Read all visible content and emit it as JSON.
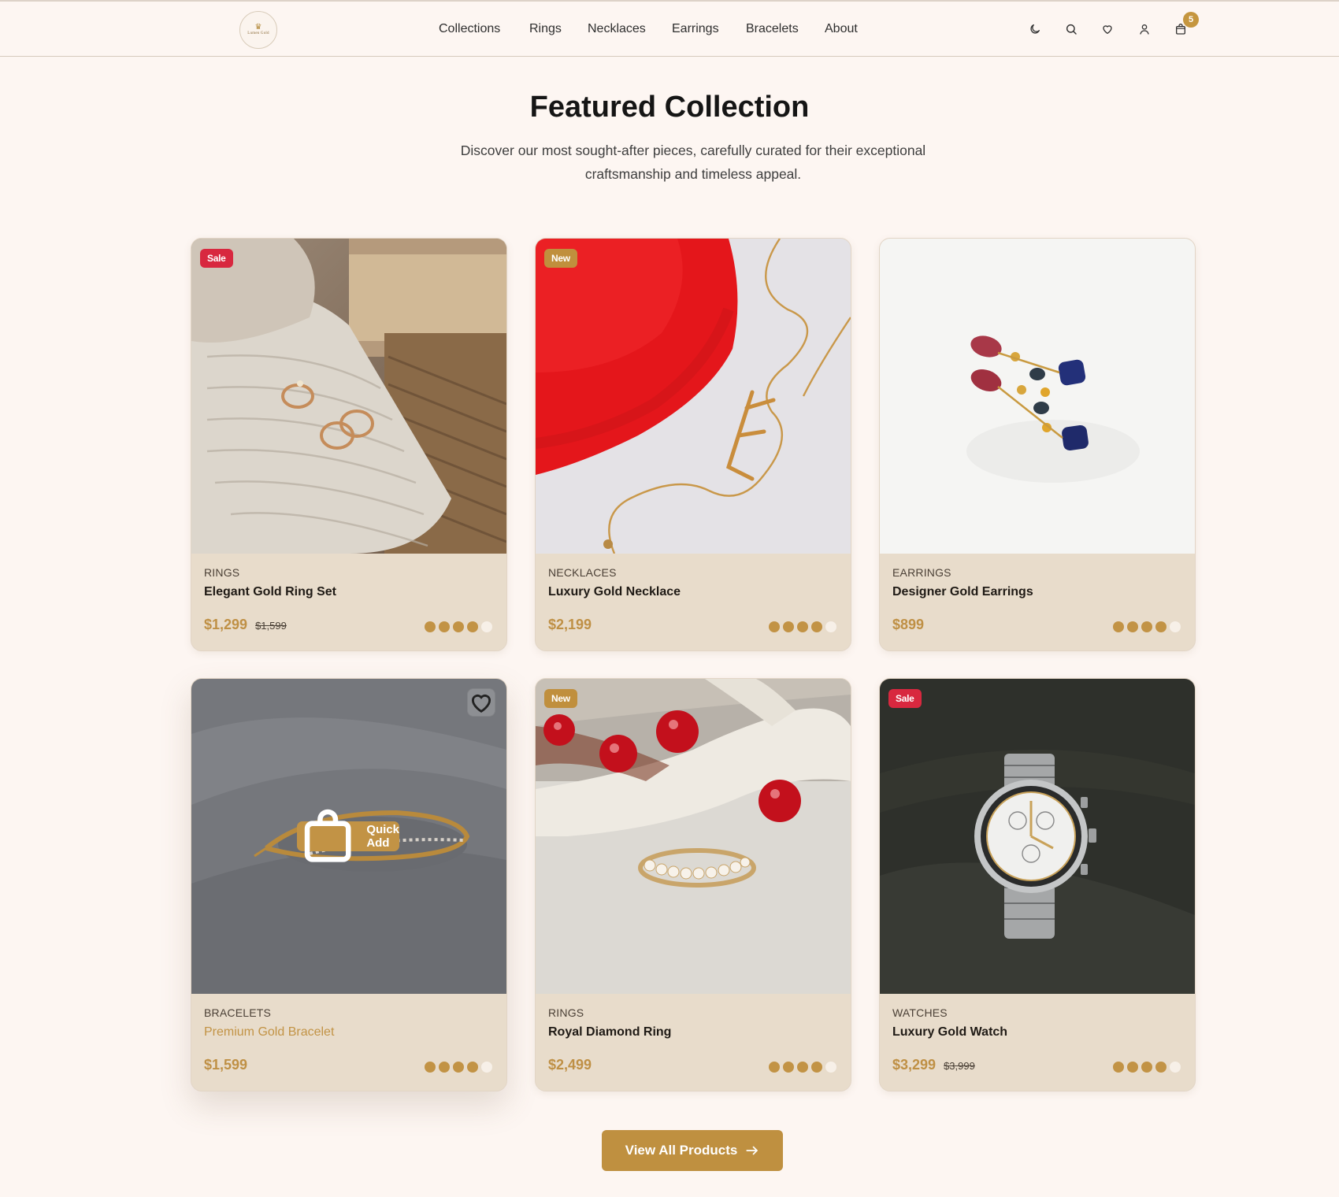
{
  "brand": {
    "logo_text": "Lumen Gold"
  },
  "nav": {
    "items": [
      "Collections",
      "Rings",
      "Necklaces",
      "Earrings",
      "Bracelets",
      "About"
    ]
  },
  "header_icons": [
    "moon-icon",
    "search-icon",
    "heart-icon",
    "user-icon",
    "cart-icon"
  ],
  "cart": {
    "count": "5"
  },
  "section": {
    "title": "Featured Collection",
    "subtitle": "Discover our most sought-after pieces, carefully curated for their exceptional craftsmanship and timeless appeal."
  },
  "products": [
    {
      "badge": "Sale",
      "category": "RINGS",
      "name": "Elegant Gold Ring Set",
      "price": "$1,299",
      "old_price": "$1,599",
      "rating": 4
    },
    {
      "badge": "New",
      "category": "NECKLACES",
      "name": "Luxury Gold Necklace",
      "price": "$2,199",
      "old_price": "",
      "rating": 4
    },
    {
      "badge": "",
      "category": "EARRINGS",
      "name": "Designer Gold Earrings",
      "price": "$899",
      "old_price": "",
      "rating": 4
    },
    {
      "badge": "",
      "category": "BRACELETS",
      "name": "Premium Gold Bracelet",
      "price": "$1,599",
      "old_price": "",
      "rating": 4,
      "hovered": true,
      "quick_add_label": "Quick Add"
    },
    {
      "badge": "New",
      "category": "RINGS",
      "name": "Royal Diamond Ring",
      "price": "$2,499",
      "old_price": "",
      "rating": 4
    },
    {
      "badge": "Sale",
      "category": "WATCHES",
      "name": "Luxury Gold Watch",
      "price": "$3,299",
      "old_price": "$3,999",
      "rating": 4
    }
  ],
  "cta": {
    "label": "View All Products",
    "icon": "arrow-right-icon"
  },
  "colors": {
    "gold": "#c29345",
    "sale": "#d8283f",
    "card_body": "#e8dccb",
    "page_bg": "#fdf6f2"
  }
}
